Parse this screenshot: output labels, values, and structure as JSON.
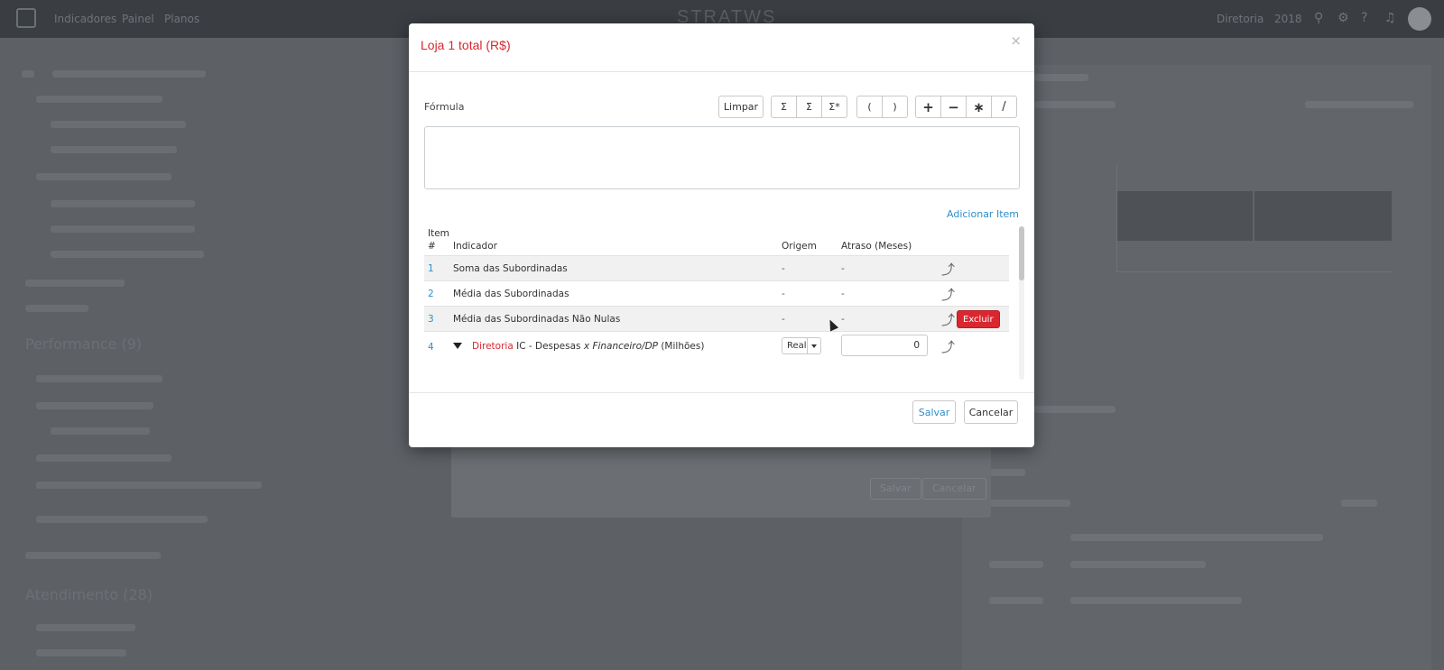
{
  "modal": {
    "title": "Loja 1 total (R$)",
    "close_label": "×",
    "formula_label": "Fórmula",
    "formula_value": "",
    "toolbar": {
      "clear_label": "Limpar",
      "sum_labels": [
        "Σ",
        "Σ̄",
        "Σ*"
      ],
      "paren_labels": [
        "(",
        ")"
      ],
      "operator_labels": [
        "+",
        "−",
        "∗",
        "/"
      ]
    },
    "add_item_label": "Adicionar Item",
    "table": {
      "headers": {
        "item_top": "Item",
        "item_bottom": "#",
        "indicator": "Indicador",
        "origin": "Origem",
        "delay": "Atraso (Meses)"
      },
      "rows": [
        {
          "num": "1",
          "indicator": "Soma das Subordinadas",
          "origin": "-",
          "delay": "-"
        },
        {
          "num": "2",
          "indicator": "Média das Subordinadas",
          "origin": "-",
          "delay": "-"
        },
        {
          "num": "3",
          "indicator": "Média das Subordinadas Não Nulas",
          "origin": "-",
          "delay": "-",
          "delete_label": "Excluir"
        },
        {
          "num": "4",
          "indicator_prefix": "Diretoria",
          "indicator_main": "IC - Despesas",
          "indicator_x": "x",
          "indicator_italic": "Financeiro/DP",
          "indicator_suffix": "(Milhões)",
          "origin": "Real",
          "delay": "0"
        }
      ]
    },
    "save_label": "Salvar",
    "cancel_label": "Cancelar"
  },
  "background": {
    "nav": [
      "Indicadores",
      "Painel",
      "Planos"
    ],
    "brand": "STRATWS",
    "right_nav": [
      "Diretoria",
      "2018"
    ],
    "sections": [
      "Performance (9)",
      "Atendimento (28)"
    ],
    "under_modal": {
      "save_label": "Salvar",
      "cancel_label": "Cancelar"
    }
  },
  "colors": {
    "accent_red": "#d9262f",
    "link_blue": "#2e8fc9",
    "overlay": "#5d6166"
  }
}
